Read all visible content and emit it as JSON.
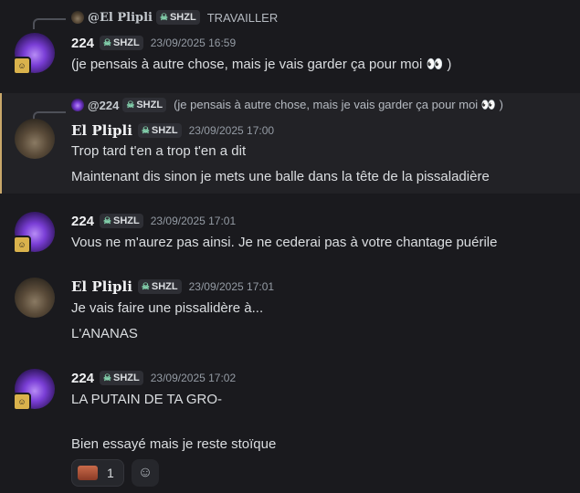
{
  "messages": [
    {
      "reply": {
        "author": "@El Plipli",
        "tag": "SHZL",
        "text": "TRAVAILLER"
      },
      "author": "224",
      "tag": "SHZL",
      "time": "23/09/2025 16:59",
      "lines": [
        "(je pensais à autre chose, mais je vais garder ça pour moi 👀 )"
      ]
    },
    {
      "reply": {
        "author": "@224",
        "tag": "SHZL",
        "text": "(je pensais à autre chose, mais je vais garder ça pour moi 👀 )"
      },
      "author": "El Plipli",
      "tag": "SHZL",
      "time": "23/09/2025 17:00",
      "lines": [
        "Trop tard t'en a trop t'en a dit",
        "Maintenant dis sinon je mets une balle dans la tête de la pissaladière"
      ]
    },
    {
      "author": "224",
      "tag": "SHZL",
      "time": "23/09/2025 17:01",
      "lines": [
        "Vous ne m'aurez pas ainsi. Je ne cederai pas à votre chantage puérile"
      ]
    },
    {
      "author": "El Plipli",
      "tag": "SHZL",
      "time": "23/09/2025 17:01",
      "lines": [
        "Je vais faire une pissalidère à...",
        "L'ANANAS"
      ]
    },
    {
      "author": "224",
      "tag": "SHZL",
      "time": "23/09/2025 17:02",
      "lines": [
        "LA PUTAIN DE TA GRO-",
        "Bien essayé mais je reste stoïque"
      ],
      "reaction": {
        "count": "1"
      }
    }
  ],
  "icons": {
    "skull": "skull-icon",
    "add_reaction": "smiley-icon",
    "reaction_emoji": "face-emoji"
  }
}
